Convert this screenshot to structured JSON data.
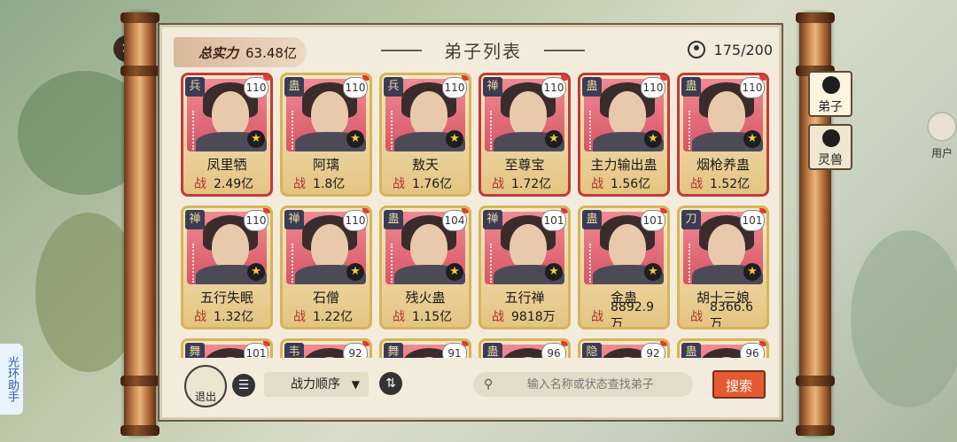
{
  "header": {
    "strength_label": "总实力",
    "strength_value": "63.48亿",
    "title": "弟子列表",
    "count": "175/200"
  },
  "side_tabs": [
    {
      "label": "弟子",
      "active": true
    },
    {
      "label": "灵兽",
      "active": false
    }
  ],
  "helper_label": "光环助手",
  "user_center_label": "用户",
  "disciples": [
    {
      "sect": "兵",
      "level": "110",
      "name": "凤里牺",
      "power": "2.49亿",
      "frame": "red"
    },
    {
      "sect": "蛊",
      "level": "110",
      "name": "阿璃",
      "power": "1.8亿",
      "frame": "gold"
    },
    {
      "sect": "兵",
      "level": "110",
      "name": "敖天",
      "power": "1.76亿",
      "frame": "gold"
    },
    {
      "sect": "禅",
      "level": "110",
      "name": "至尊宝",
      "power": "1.72亿",
      "frame": "red"
    },
    {
      "sect": "蛊",
      "level": "110",
      "name": "主力输出蛊",
      "power": "1.56亿",
      "frame": "red"
    },
    {
      "sect": "蛊",
      "level": "110",
      "name": "烟枪养蛊",
      "power": "1.52亿",
      "frame": "red"
    },
    {
      "sect": "禅",
      "level": "110",
      "name": "五行失眠",
      "power": "1.32亿",
      "frame": "gold"
    },
    {
      "sect": "禅",
      "level": "110",
      "name": "石僧",
      "power": "1.22亿",
      "frame": "gold"
    },
    {
      "sect": "蛊",
      "level": "104",
      "name": "残火蛊",
      "power": "1.15亿",
      "frame": "gold"
    },
    {
      "sect": "禅",
      "level": "101",
      "name": "五行禅",
      "power": "9818万",
      "frame": "gold"
    },
    {
      "sect": "蛊",
      "level": "101",
      "name": "金蛊",
      "power": "8892.9万",
      "frame": "gold"
    },
    {
      "sect": "刀",
      "level": "101",
      "name": "胡十三娘",
      "power": "8366.6万",
      "frame": "gold"
    },
    {
      "sect": "舞",
      "level": "101",
      "name": "",
      "power": "",
      "frame": "gold"
    },
    {
      "sect": "韦",
      "level": "92",
      "name": "",
      "power": "",
      "frame": "gold"
    },
    {
      "sect": "舞",
      "level": "91",
      "name": "",
      "power": "",
      "frame": "gold"
    },
    {
      "sect": "蛊",
      "level": "96",
      "name": "",
      "power": "",
      "frame": "gold"
    },
    {
      "sect": "隐",
      "level": "92",
      "name": "",
      "power": "",
      "frame": "gold"
    },
    {
      "sect": "蛊",
      "level": "96",
      "name": "",
      "power": "",
      "frame": "gold"
    }
  ],
  "power_prefix": "战",
  "toolbar": {
    "exit_label": "退出",
    "sort_label": "战力顺序",
    "search_placeholder": "输入名称或状态查找弟子",
    "search_button": "搜索"
  },
  "colors": {
    "accent_red": "#e35a32",
    "card_gold": "#d7b45a",
    "card_red": "#c23a3a",
    "portrait_pink": "#f08a94"
  }
}
